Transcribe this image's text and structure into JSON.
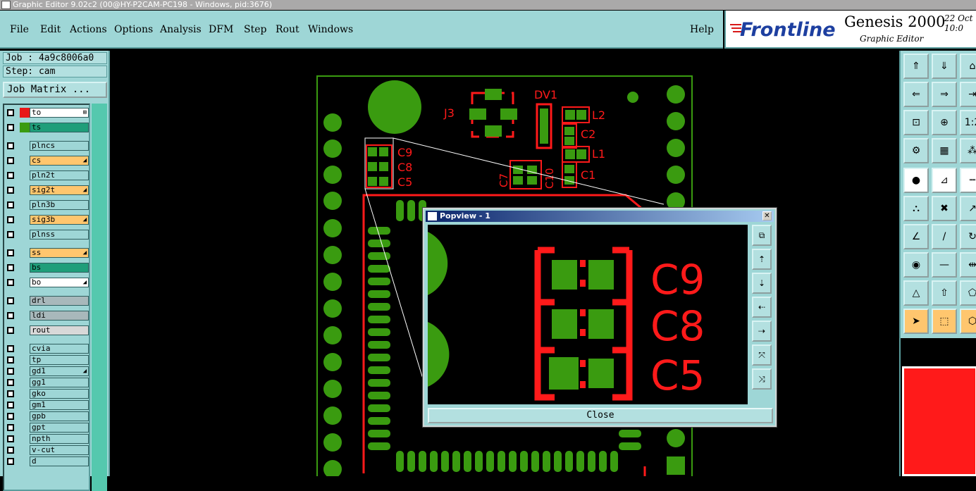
{
  "window": {
    "title": "Graphic Editor 9.02c2 (00@HY-P2CAM-PC198 - Windows, pid:3676)"
  },
  "menu": [
    "File",
    "Edit",
    "Actions",
    "Options",
    "Analysis",
    "DFM",
    "Step",
    "Rout",
    "Windows"
  ],
  "help_label": "Help",
  "brand": {
    "logo": "Frontline",
    "title": "Genesis 2000",
    "subtitle": "Graphic Editor",
    "date": "22 Oct",
    "time": "10:0"
  },
  "job": {
    "label": "Job : 4a9c8006a0",
    "step": "Step: cam",
    "matrix_button": "Job Matrix ..."
  },
  "layers": [
    {
      "name": "to",
      "bg": "#ffffff",
      "mark": "⊞"
    },
    {
      "name": "ts",
      "bg": "#1f9e7a",
      "mark": ""
    },
    {
      "name": "plncs",
      "bg": "#9ed6d6",
      "mark": ""
    },
    {
      "name": "cs",
      "bg": "#ffc66e",
      "mark": "◢"
    },
    {
      "name": "pln2t",
      "bg": "#9ed6d6",
      "mark": ""
    },
    {
      "name": "sig2t",
      "bg": "#ffc66e",
      "mark": "◢"
    },
    {
      "name": "pln3b",
      "bg": "#9ed6d6",
      "mark": ""
    },
    {
      "name": "sig3b",
      "bg": "#ffc66e",
      "mark": "◢"
    },
    {
      "name": "plnss",
      "bg": "#9ed6d6",
      "mark": ""
    },
    {
      "name": "ss",
      "bg": "#ffc66e",
      "mark": "◢"
    },
    {
      "name": "bs",
      "bg": "#1f9e7a",
      "mark": ""
    },
    {
      "name": "bo",
      "bg": "#ffffff",
      "mark": "◢"
    },
    {
      "name": "drl",
      "bg": "#a8b8bb",
      "mark": ""
    },
    {
      "name": "ldi",
      "bg": "#a8b8bb",
      "mark": ""
    },
    {
      "name": "rout",
      "bg": "#d8d8d8",
      "mark": ""
    },
    {
      "name": "cvia",
      "bg": "#9ed6d6",
      "mark": ""
    },
    {
      "name": "tp",
      "bg": "#9ed6d6",
      "mark": ""
    },
    {
      "name": "gd1",
      "bg": "#9ed6d6",
      "mark": "◢"
    },
    {
      "name": "gg1",
      "bg": "#9ed6d6",
      "mark": ""
    },
    {
      "name": "gko",
      "bg": "#9ed6d6",
      "mark": ""
    },
    {
      "name": "gm1",
      "bg": "#9ed6d6",
      "mark": ""
    },
    {
      "name": "gpb",
      "bg": "#9ed6d6",
      "mark": ""
    },
    {
      "name": "gpt",
      "bg": "#9ed6d6",
      "mark": ""
    },
    {
      "name": "npth",
      "bg": "#9ed6d6",
      "mark": ""
    },
    {
      "name": "v-cut",
      "bg": "#9ed6d6",
      "mark": ""
    },
    {
      "name": "d",
      "bg": "#9ed6d6",
      "mark": ""
    }
  ],
  "pcb": {
    "refs": [
      "J3",
      "DV1",
      "L2",
      "C2",
      "L1",
      "C1",
      "C9",
      "C8",
      "C5",
      "C7",
      "C10"
    ]
  },
  "popview": {
    "title": "Popview - 1",
    "close_label": "Close",
    "refs": [
      "C9",
      "C8",
      "C5"
    ]
  },
  "colors": {
    "panel": "#9ed6d6",
    "copper": "#3a9b10",
    "silk": "#ff1a1a"
  }
}
